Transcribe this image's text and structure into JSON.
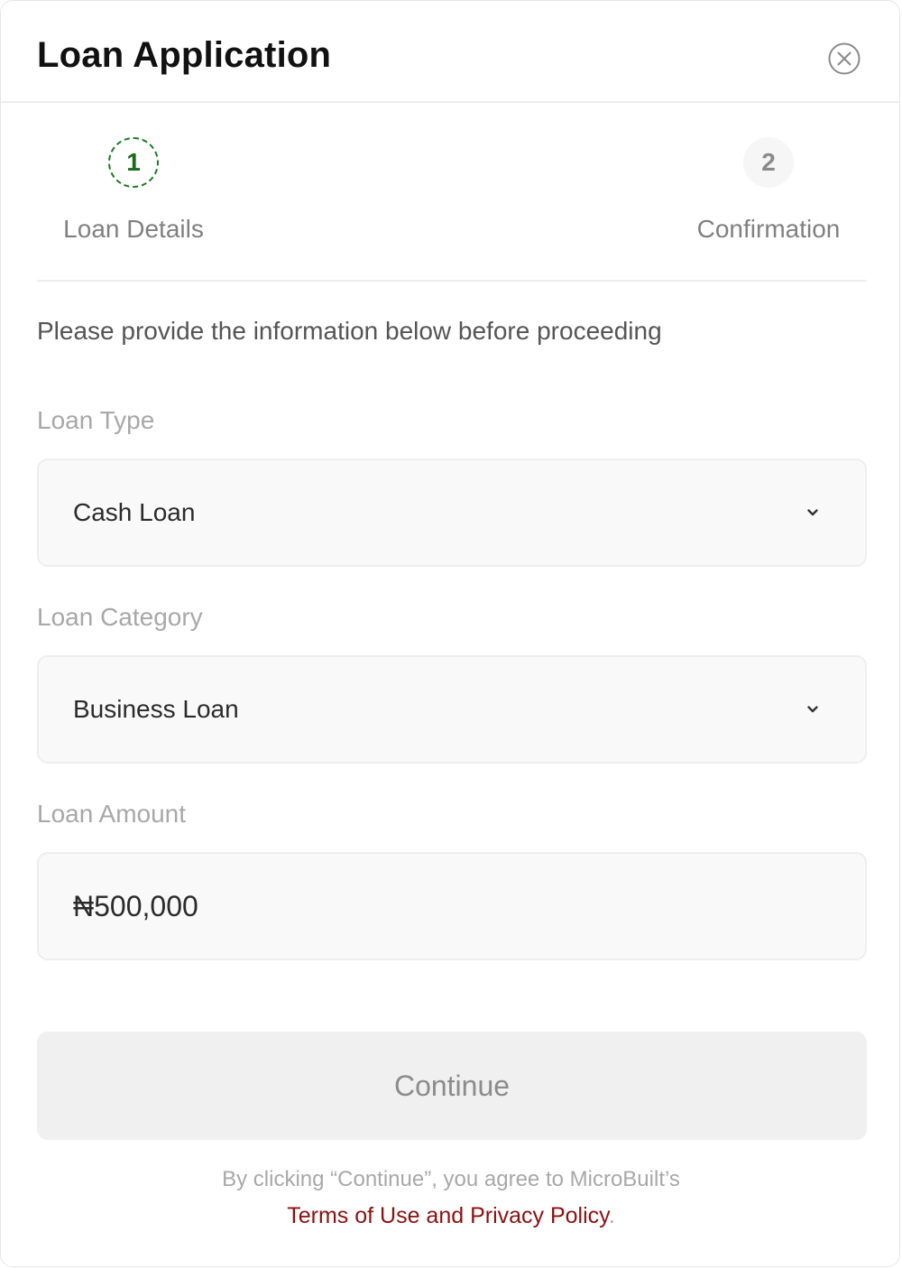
{
  "modal": {
    "title": "Loan Application"
  },
  "steps": [
    {
      "number": "1",
      "label": "Loan Details",
      "state": "active"
    },
    {
      "number": "2",
      "label": "Confirmation",
      "state": "inactive"
    }
  ],
  "intro_text": "Please provide the information below before proceeding",
  "fields": {
    "loan_type": {
      "label": "Loan Type",
      "value": "Cash Loan"
    },
    "loan_category": {
      "label": "Loan Category",
      "value": "Business Loan"
    },
    "loan_amount": {
      "label": "Loan Amount",
      "value": "₦500,000"
    }
  },
  "continue_label": "Continue",
  "footer": {
    "agreement_text": "By clicking “Continue”, you agree to MicroBuilt’s",
    "terms_link": "Terms of Use and Privacy Policy",
    "period": "."
  },
  "colors": {
    "active_step": "#1e7a22",
    "link": "#8c1010",
    "button_bg": "#f0f0f0"
  },
  "icons": {
    "close": "close-circle-icon",
    "dropdown": "chevron-down-icon"
  }
}
